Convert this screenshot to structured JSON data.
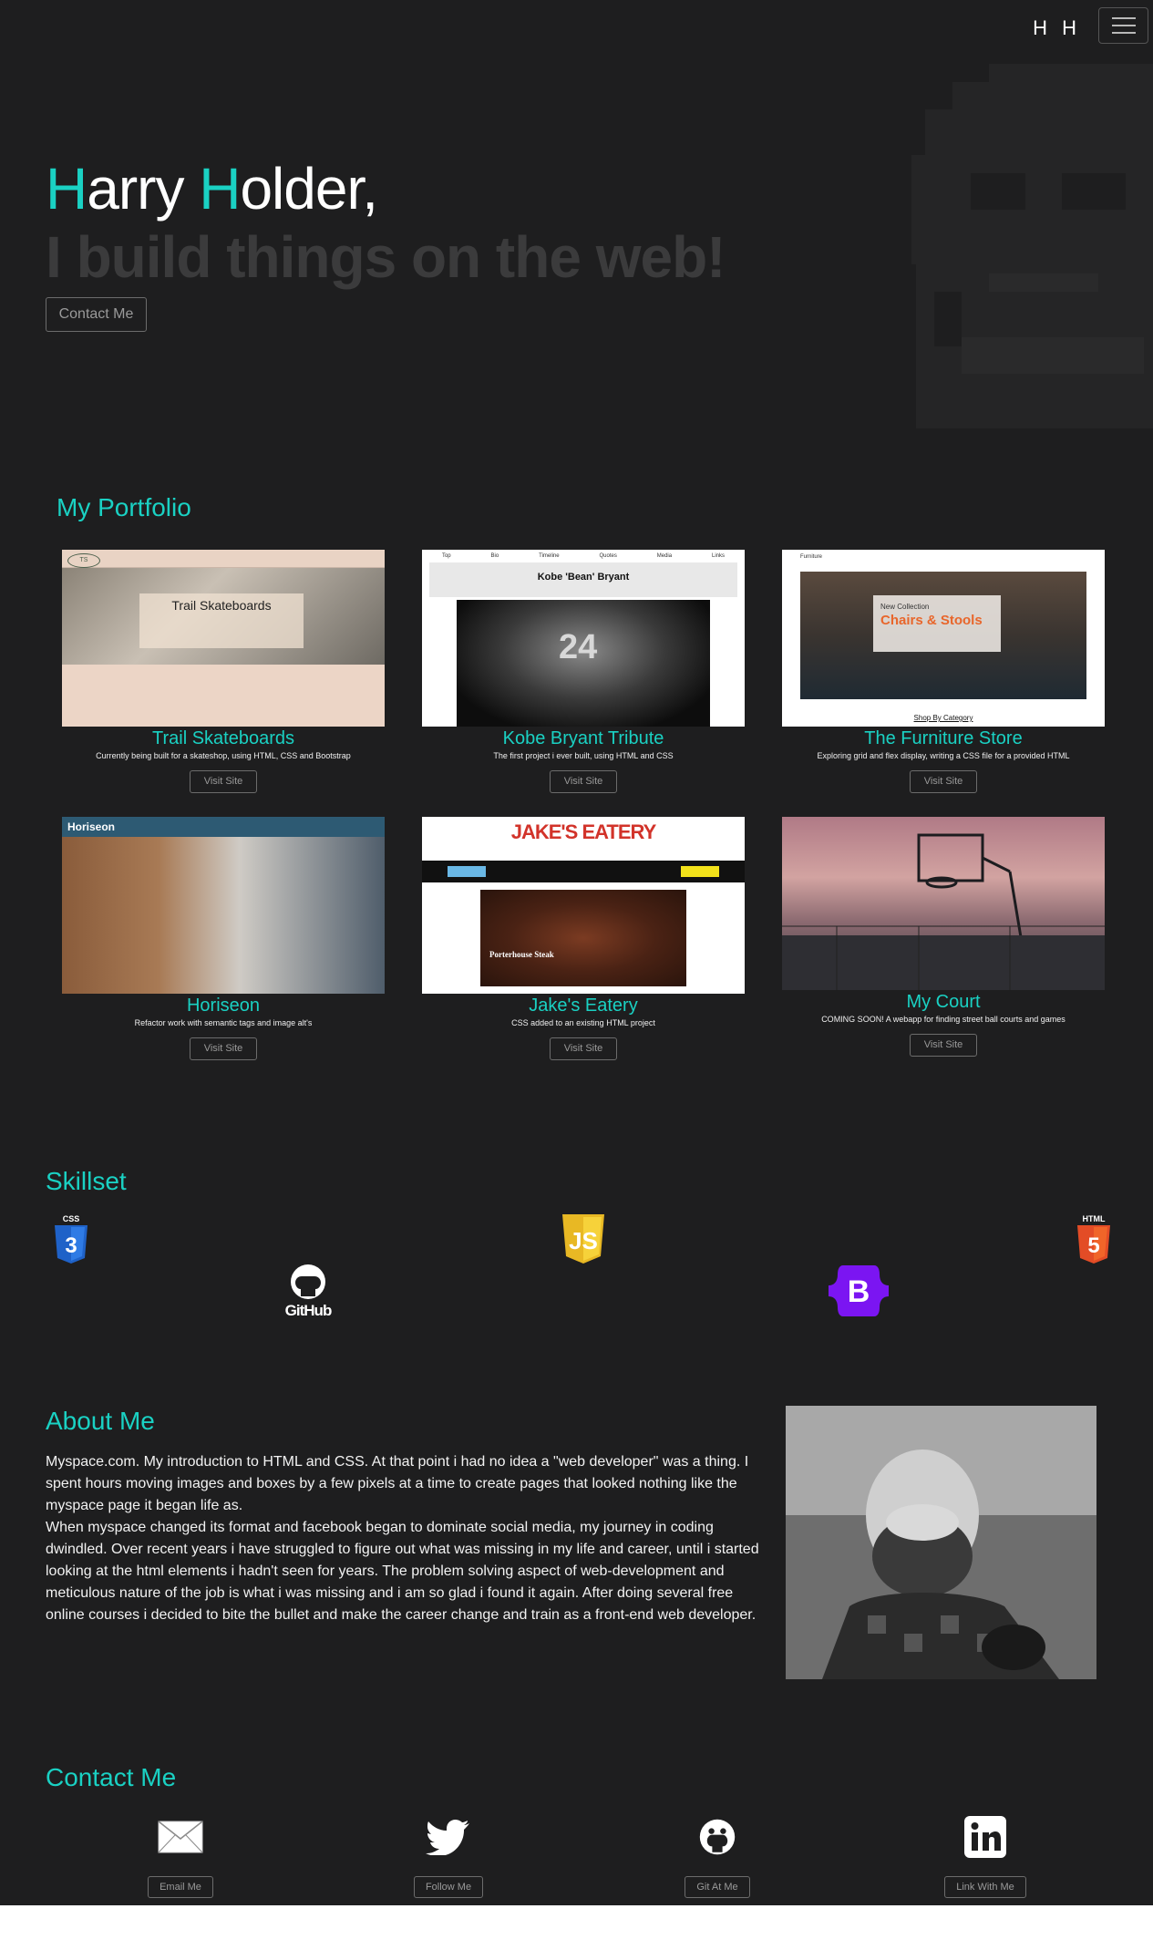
{
  "navbar": {
    "brand": "H H"
  },
  "hero": {
    "name_first_initial": "H",
    "name_first_rest": "arry ",
    "name_last_initial": "H",
    "name_last_rest": "older,",
    "tagline": "I build things on the web!",
    "contact_button": "Contact Me"
  },
  "portfolio": {
    "title": "My Portfolio",
    "visit_label": "Visit Site",
    "projects": [
      {
        "title": "Trail Skateboards",
        "desc": "Currently being built for a skateshop, using HTML, CSS and Bootstrap",
        "thumb_heading": "Trail Skateboards",
        "thumb_logo": "TS"
      },
      {
        "title": "Kobe Bryant Tribute",
        "desc": "The first project i ever built, using HTML and CSS",
        "thumb_heading": "Kobe 'Bean' Bryant",
        "thumb_nav": [
          "Top",
          "Bio",
          "Timeline",
          "Quotes",
          "Media",
          "Links"
        ],
        "thumb_number": "24"
      },
      {
        "title": "The Furniture Store",
        "desc": "Exploring grid and flex display, writing a CSS file for a provided HTML",
        "thumb_nav": "Furniture",
        "thumb_sub": "New Collection",
        "thumb_heading": "Chairs & Stools",
        "thumb_cat": "Shop By Category"
      },
      {
        "title": "Horiseon",
        "desc": "Refactor work with semantic tags and image alt's",
        "thumb_heading": "Horiseon"
      },
      {
        "title": "Jake's Eatery",
        "desc": "CSS added to an existing HTML project",
        "thumb_heading": "JAKE'S EATERY",
        "thumb_item": "Porterhouse Steak"
      },
      {
        "title": "My Court",
        "desc": "COMING SOON! A webapp for finding street ball courts and games"
      }
    ]
  },
  "skills": {
    "title": "Skillset",
    "items": [
      {
        "name": "css3-icon",
        "label": "CSS"
      },
      {
        "name": "github-icon",
        "label": "GitHub"
      },
      {
        "name": "javascript-icon",
        "label": "JS"
      },
      {
        "name": "bootstrap-icon",
        "label": "B"
      },
      {
        "name": "html5-icon",
        "label": "HTML"
      }
    ]
  },
  "about": {
    "title": "About Me",
    "paragraph1": "Myspace.com. My introduction to HTML and CSS. At that point i had no idea a \"web developer\" was a thing. I spent hours moving images and boxes by a few pixels at a time to create pages that looked nothing like the myspace page it began life as.",
    "paragraph2": "When myspace changed its format and facebook began to dominate social media, my journey in coding dwindled. Over recent years i have struggled to figure out what was missing in my life and career, until i started looking at the html elements i hadn't seen for years. The problem solving aspect of web-development and meticulous nature of the job is what i was missing and i am so glad i found it again. After doing several free online courses i decided to bite the bullet and make the career change and train as a front-end web developer."
  },
  "contact": {
    "title": "Contact Me",
    "items": [
      {
        "icon": "envelope-icon",
        "label": "Email Me"
      },
      {
        "icon": "twitter-icon",
        "label": "Follow Me"
      },
      {
        "icon": "github-icon",
        "label": "Git At Me"
      },
      {
        "icon": "linkedin-icon",
        "label": "Link With Me"
      }
    ]
  },
  "colors": {
    "accent": "#1ad1c3",
    "background": "#1e1e1f",
    "tagline": "#3b3b3c"
  }
}
